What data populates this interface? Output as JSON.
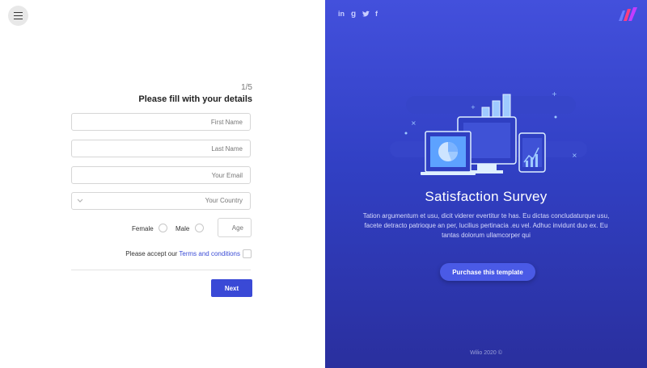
{
  "header": {
    "menu_icon": "hamburger-menu-icon"
  },
  "form": {
    "step": "1/5",
    "title": "Please fill with your details",
    "fields": {
      "first_name": "First Name",
      "last_name": "Last Name",
      "email": "Your Email",
      "country": "Your Country"
    },
    "gender": {
      "female": "Female",
      "male": "Male"
    },
    "age_placeholder": "Age",
    "terms": {
      "text": "Please accept our",
      "link": "Terms and conditions"
    },
    "next": "Next"
  },
  "social": {
    "linkedin": "in",
    "google": "g",
    "twitter": "t",
    "facebook": "f"
  },
  "hero": {
    "title": "Satisfaction Survey",
    "description": "Tation argumentum et usu, dicit viderer evertitur te has. Eu dictas concludaturque usu, facete detracto patrioque an per, lucilius pertinacia .eu vel. Adhuc invidunt duo ex. Eu tantas dolorum ullamcorper qui",
    "button": "Purchase this template",
    "footer": "Wilio 2020 ©"
  },
  "colors": {
    "accent": "#3a49d6",
    "panel_top": "#4350dc",
    "panel_bottom": "#2a2f9e"
  }
}
